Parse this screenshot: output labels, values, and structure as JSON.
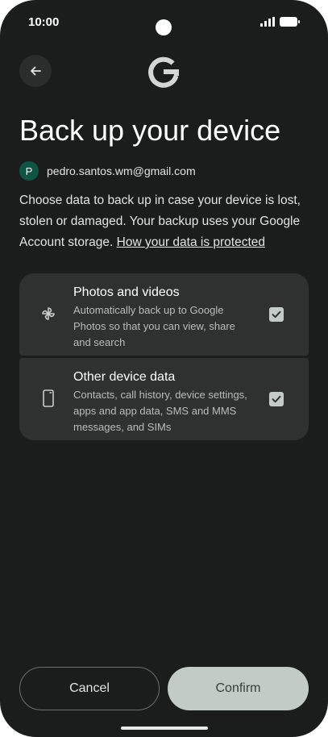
{
  "status_bar": {
    "time": "10:00"
  },
  "header": {
    "title": "Back up your device"
  },
  "account": {
    "initial": "P",
    "email": "pedro.santos.wm@gmail.com"
  },
  "description": {
    "text": "Choose data to back up in case your device is lost, stolen or damaged. Your backup uses your Google Account storage.",
    "link": "How your data is protected"
  },
  "options": [
    {
      "title": "Photos and videos",
      "subtitle": "Automatically back up to Google Photos so that you can view, share and search",
      "checked": true,
      "icon": "pinwheel-icon"
    },
    {
      "title": "Other device data",
      "subtitle": "Contacts, call history, device settings, apps and app data, SMS and MMS messages, and SIMs",
      "checked": true,
      "icon": "phone-icon"
    }
  ],
  "footer": {
    "cancel_label": "Cancel",
    "confirm_label": "Confirm"
  },
  "colors": {
    "background": "#1b1d1c",
    "card": "#2e3130",
    "confirm": "#c3cbc6",
    "avatar": "#0f5445"
  }
}
